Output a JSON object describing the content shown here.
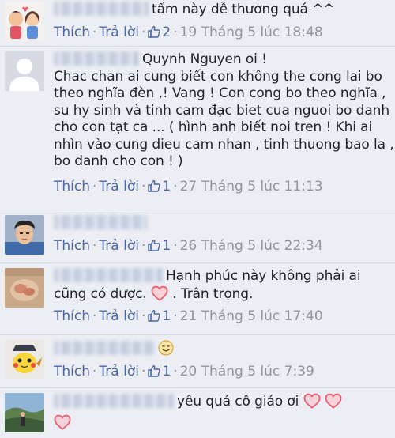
{
  "actions": {
    "like_label": "Thích",
    "reply_label": "Trả lời",
    "separator": "·"
  },
  "comments": [
    {
      "text_lines": [
        "tấm này dễ thương quá ^^"
      ],
      "like_count": "2",
      "timestamp": "19 Tháng 5 lúc 18:48"
    },
    {
      "text_lines": [
        "Quynh Nguyen oi !",
        "Chac chan ai cung biết con không the cong lai bo",
        "theo nghĩa đèn ,! Vang ! Con cong bo theo nghĩa ,",
        "su hy sinh và tinh cam đạc biet cua nguoi bo danh",
        "cho con tạt ca ... ( hình anh biết noi tren ! Khi ai",
        "nhìn vào cung dieu cam nhan , tinh thuong bao la ,",
        "bo danh cho con ! )"
      ],
      "like_count": "1",
      "timestamp": "27 Tháng 5 lúc 11:13"
    },
    {
      "text_lines": [],
      "like_count": "1",
      "timestamp": "26 Tháng 5 lúc 22:34"
    },
    {
      "text_lines": [
        "Hạnh phúc này không phải ai",
        "cũng có được.",
        ". Trân trọng."
      ],
      "like_count": "1",
      "timestamp": "21 Tháng 5 lúc 17:40"
    },
    {
      "text_lines": [],
      "like_count": "1",
      "timestamp": "20 Tháng 5 lúc 7:39"
    },
    {
      "text_lines": [
        "yêu quá cô giáo ơi"
      ],
      "like_count": "",
      "timestamp": ""
    }
  ],
  "colors": {
    "link": "#4b67a1",
    "meta": "#90949c",
    "heart": "#f25268",
    "background": "#eceef3"
  },
  "icons": [
    "like-thumb-icon",
    "heart-emoji-icon",
    "smile-emoji-icon",
    "avatar"
  ]
}
